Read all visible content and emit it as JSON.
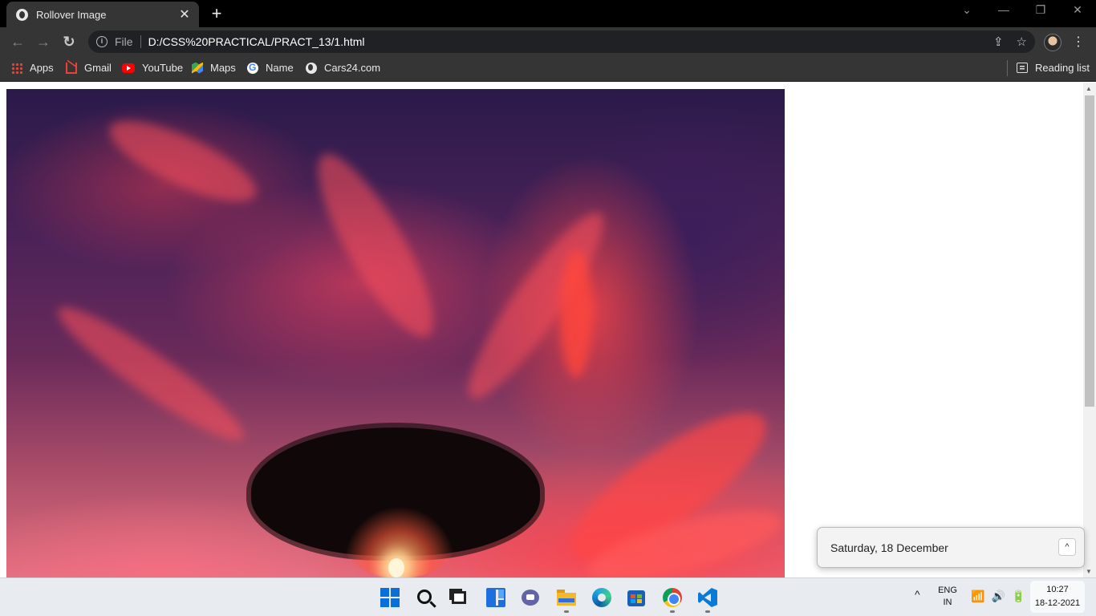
{
  "browser": {
    "tab": {
      "title": "Rollover Image",
      "close_label": "✕"
    },
    "new_tab_label": "+",
    "window_controls": {
      "minimize": "—",
      "restore": "❐",
      "close": "✕"
    },
    "nav": {
      "back": "←",
      "forward": "→",
      "reload": "↻"
    },
    "omnibox": {
      "scheme_label": "File",
      "url": "D:/CSS%20PRACTICAL/PRACT_13/1.html",
      "share_icon": "⇪",
      "star_icon": "☆"
    },
    "menu_label": "⋮",
    "bookmarks": [
      {
        "label": "Apps",
        "icon": "apps-grid-icon"
      },
      {
        "label": "Gmail",
        "icon": "gmail-icon"
      },
      {
        "label": "YouTube",
        "icon": "youtube-icon"
      },
      {
        "label": "Maps",
        "icon": "maps-icon"
      },
      {
        "label": "Name",
        "icon": "google-icon"
      },
      {
        "label": "Cars24.com",
        "icon": "globe-icon"
      }
    ],
    "reading_list_label": "Reading list"
  },
  "page": {
    "image_name": "sunset-tree-photo"
  },
  "notification": {
    "date_text": "Saturday, 18 December",
    "collapse_icon": "^"
  },
  "taskbar": {
    "apps": [
      "start",
      "search",
      "task-view",
      "widgets",
      "teams-chat",
      "file-explorer",
      "edge",
      "microsoft-store",
      "chrome",
      "vscode"
    ],
    "tray": {
      "chevron": "^",
      "language_line1": "ENG",
      "language_line2": "IN",
      "wifi_icon": "📶",
      "volume_icon": "🔊",
      "battery_icon": "🔋",
      "time": "10:27",
      "date": "18-12-2021"
    }
  },
  "colors": {
    "titlebar": "#000000",
    "toolbar": "#353535",
    "omnibox": "#202124",
    "taskbar": "#e8ecf1"
  }
}
